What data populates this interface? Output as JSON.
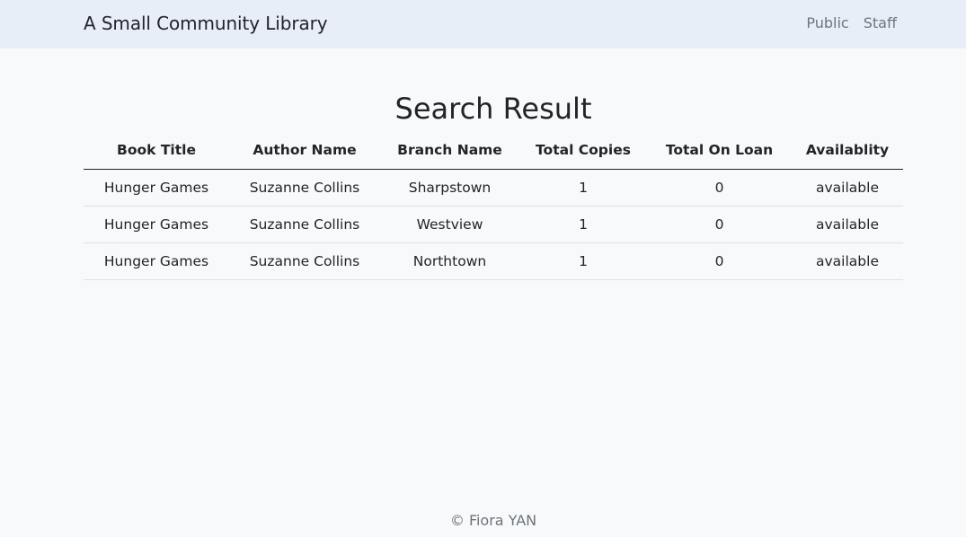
{
  "navbar": {
    "brand": "A Small Community Library",
    "links": [
      "Public",
      "Staff"
    ]
  },
  "main": {
    "title": "Search Result",
    "table": {
      "headers": [
        "Book Title",
        "Author Name",
        "Branch Name",
        "Total Copies",
        "Total On Loan",
        "Availablity"
      ],
      "rows": [
        [
          "Hunger Games",
          "Suzanne Collins",
          "Sharpstown",
          "1",
          "0",
          "available"
        ],
        [
          "Hunger Games",
          "Suzanne Collins",
          "Westview",
          "1",
          "0",
          "available"
        ],
        [
          "Hunger Games",
          "Suzanne Collins",
          "Northtown",
          "1",
          "0",
          "available"
        ]
      ]
    }
  },
  "footer": {
    "text": "© Fiora YAN"
  },
  "colors": {
    "navbar_bg": "#e7eef8",
    "page_bg": "#f8f9fa",
    "muted_text": "#6c757d"
  }
}
